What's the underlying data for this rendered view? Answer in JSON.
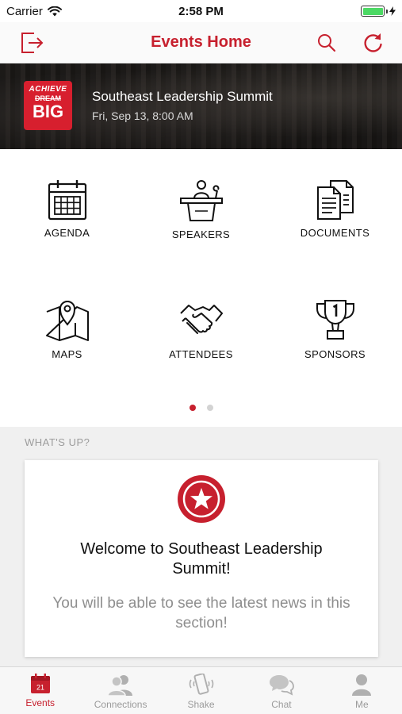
{
  "status_bar": {
    "carrier": "Carrier",
    "time": "2:58 PM",
    "battery_level": 1.0
  },
  "nav": {
    "title": "Events Home",
    "left_icon": "exit-icon",
    "right_icons": [
      "search-icon",
      "refresh-icon"
    ],
    "accent_color": "#c7202e"
  },
  "banner": {
    "logo": {
      "line1": "ACHIEVE",
      "line2": "DREAM",
      "line3": "BIG"
    },
    "event_name": "Southeast Leadership Summit",
    "event_date": "Fri, Sep 13, 8:00 AM"
  },
  "grid": {
    "tiles": [
      {
        "label": "AGENDA",
        "icon": "calendar-icon"
      },
      {
        "label": "SPEAKERS",
        "icon": "podium-icon"
      },
      {
        "label": "DOCUMENTS",
        "icon": "documents-icon"
      },
      {
        "label": "MAPS",
        "icon": "map-icon"
      },
      {
        "label": "ATTENDEES",
        "icon": "handshake-icon"
      },
      {
        "label": "SPONSORS",
        "icon": "trophy-icon"
      }
    ],
    "pages": 2,
    "current_page": 1
  },
  "whats_up": {
    "heading": "WHAT'S UP?",
    "card": {
      "icon": "star-icon",
      "title": "Welcome to Southeast Leadership Summit!",
      "body": "You will be able to see the latest news in this section!"
    }
  },
  "tab_bar": {
    "tabs": [
      {
        "label": "Events",
        "icon": "calendar-icon",
        "badge_text": "21",
        "active": true
      },
      {
        "label": "Connections",
        "icon": "people-icon",
        "active": false
      },
      {
        "label": "Shake",
        "icon": "phone-shake-icon",
        "active": false
      },
      {
        "label": "Chat",
        "icon": "chat-icon",
        "active": false
      },
      {
        "label": "Me",
        "icon": "person-icon",
        "active": false
      }
    ]
  }
}
